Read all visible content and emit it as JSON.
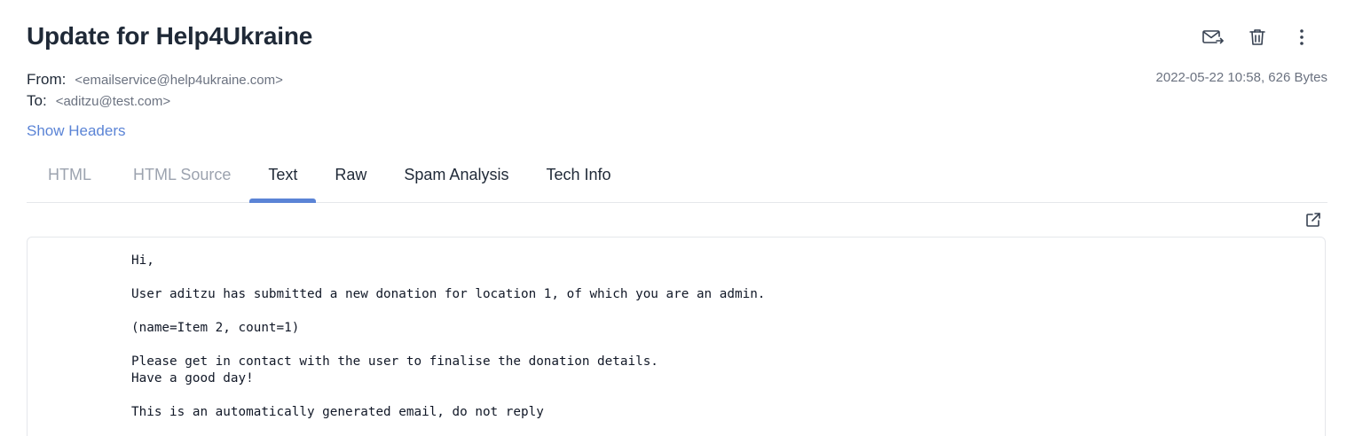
{
  "email": {
    "subject": "Update for Help4Ukraine",
    "from_label": "From:",
    "from_value": "<emailservice@help4ukraine.com>",
    "to_label": "To:",
    "to_value": "<aditzu@test.com>",
    "date_size": "2022-05-22 10:58, 626 Bytes",
    "show_headers": "Show Headers"
  },
  "actions": {
    "forward_icon": "mail-forward-icon",
    "delete_icon": "trash-icon",
    "more_icon": "more-vertical-icon"
  },
  "tabs": [
    {
      "label": "HTML",
      "state": "disabled"
    },
    {
      "label": "HTML Source",
      "state": "disabled"
    },
    {
      "label": "Text",
      "state": "active"
    },
    {
      "label": "Raw",
      "state": "normal"
    },
    {
      "label": "Spam Analysis",
      "state": "normal"
    },
    {
      "label": "Tech Info",
      "state": "normal"
    }
  ],
  "body": {
    "popout_icon": "external-link-icon",
    "text": "Hi,\n\nUser aditzu has submitted a new donation for location 1, of which you are an admin.\n\n(name=Item 2, count=1)\n\nPlease get in contact with the user to finalise the donation details.\nHave a good day!\n\nThis is an automatically generated email, do not reply"
  },
  "colors": {
    "accent": "#5b84d6",
    "text_primary": "#1f2937",
    "text_muted": "#6b7280",
    "tab_disabled": "#9ca3af",
    "border": "#e5e7eb"
  }
}
